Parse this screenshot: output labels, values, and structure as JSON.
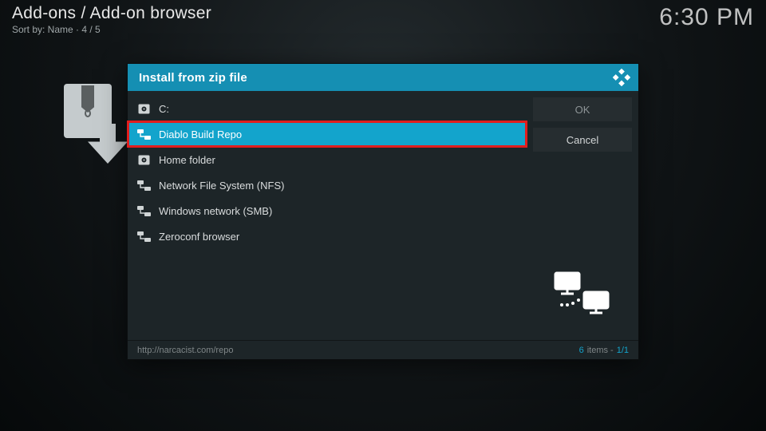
{
  "header": {
    "breadcrumb": "Add-ons / Add-on browser",
    "sort_label": "Sort by: Name  ·  4 / 5",
    "clock": "6:30 PM"
  },
  "dialog": {
    "title": "Install from zip file",
    "items": [
      {
        "label": "C:",
        "icon": "disk",
        "selected": false,
        "highlight": false
      },
      {
        "label": "Diablo Build Repo",
        "icon": "network",
        "selected": true,
        "highlight": true
      },
      {
        "label": "Home folder",
        "icon": "disk",
        "selected": false,
        "highlight": false
      },
      {
        "label": "Network File System (NFS)",
        "icon": "network",
        "selected": false,
        "highlight": false
      },
      {
        "label": "Windows network (SMB)",
        "icon": "network",
        "selected": false,
        "highlight": false
      },
      {
        "label": "Zeroconf browser",
        "icon": "network",
        "selected": false,
        "highlight": false
      }
    ],
    "buttons": {
      "ok": "OK",
      "cancel": "Cancel"
    },
    "status": {
      "path": "http://narcacist.com/repo",
      "count": "6",
      "count_suffix": " items - ",
      "page": "1/1"
    }
  }
}
